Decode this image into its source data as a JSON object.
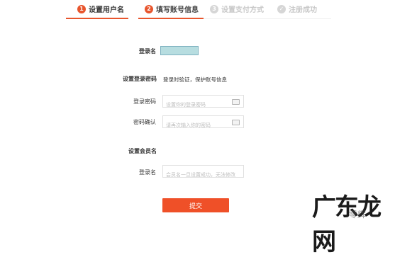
{
  "steps": [
    {
      "num": "1",
      "label": "设置用户名",
      "state": "done"
    },
    {
      "num": "2",
      "label": "填写账号信息",
      "state": "active"
    },
    {
      "num": "3",
      "label": "设置支付方式",
      "state": "inactive"
    },
    {
      "num": "✓",
      "label": "注册成功",
      "state": "inactive"
    }
  ],
  "form": {
    "username_label": "登录名",
    "password_section_title": "设置登录密码",
    "password_section_note": "登录时验证，保护账号信息",
    "password_label": "登录密码",
    "password_placeholder": "设置你的登录密码",
    "confirm_label": "密码确认",
    "confirm_placeholder": "请再次输入你的密码",
    "member_section_title": "设置会员名",
    "member_label": "登录名",
    "member_placeholder": "会员名一旦设置成功，无法修改",
    "submit_label": "提交"
  },
  "watermark": {
    "main": "广东龙网",
    "sub": "零辉"
  },
  "colors": {
    "accent": "#e8552d",
    "inactive": "#d6d6d6",
    "highlight": "#b7dde0"
  }
}
